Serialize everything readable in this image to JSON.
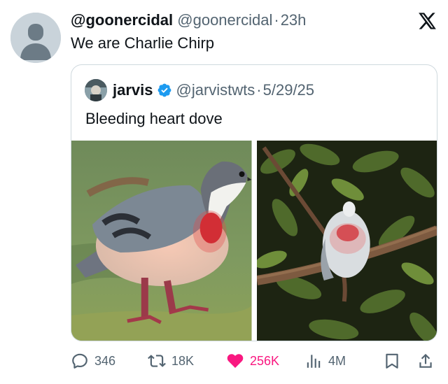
{
  "tweet": {
    "display_name": "@goonercidal",
    "handle": "@goonercidal",
    "separator": "·",
    "time": "23h",
    "text": "We are Charlie Chirp",
    "avatar_icon": "default-avatar-icon"
  },
  "quoted_tweet": {
    "display_name": "jarvis",
    "handle": "@jarvistwts",
    "separator": "·",
    "date": "5/29/25",
    "text": "Bleeding heart dove",
    "verified": true,
    "verified_color": "#1d9bf0"
  },
  "photos": [
    {
      "subject": "bleeding heart dove standing on mossy ground"
    },
    {
      "subject": "bleeding heart dove perched in tree at night"
    }
  ],
  "actions": {
    "replies": "346",
    "reposts": "18K",
    "likes": "256K",
    "views": "4M",
    "liked": true,
    "like_color": "#f91880",
    "muted_color": "#536471"
  },
  "brand": {
    "logo_icon": "x-logo-icon"
  }
}
